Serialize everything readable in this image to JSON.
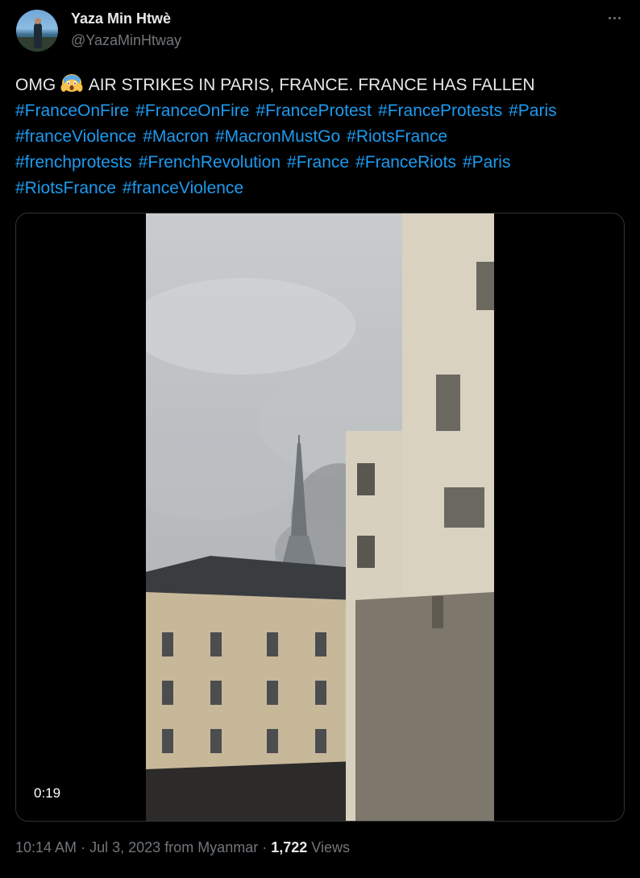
{
  "author": {
    "display_name": "Yaza Min Htwè",
    "handle": "@YazaMinHtway",
    "avatar_icon": "profile-photo"
  },
  "tweet": {
    "text_prefix": "OMG",
    "emoji": "face-screaming-in-fear",
    "text_main": " AIR STRIKES IN PARIS, FRANCE. FRANCE HAS FALLEN",
    "hashtag_lines": [
      [
        "#FranceOnFire",
        "#FranceOnFire",
        "#FranceProtest",
        "#FranceProtests",
        "#Paris"
      ],
      [
        "#franceViolence",
        "#Macron",
        "#MacronMustGo",
        "#RiotsFrance"
      ],
      [
        "#frenchprotests",
        "#FrenchRevolution",
        "#France",
        "#FranceRiots",
        "#Paris"
      ],
      [
        "#RiotsFrance",
        "#franceViolence"
      ]
    ],
    "link_color": "#1d9bf0"
  },
  "media": {
    "duration": "0:19"
  },
  "meta": {
    "time": "10:14 AM",
    "date": "Jul 3, 2023",
    "location": "from Myanmar",
    "views_count": "1,722",
    "views_label": "Views"
  },
  "icons": {
    "more": "more-icon"
  }
}
